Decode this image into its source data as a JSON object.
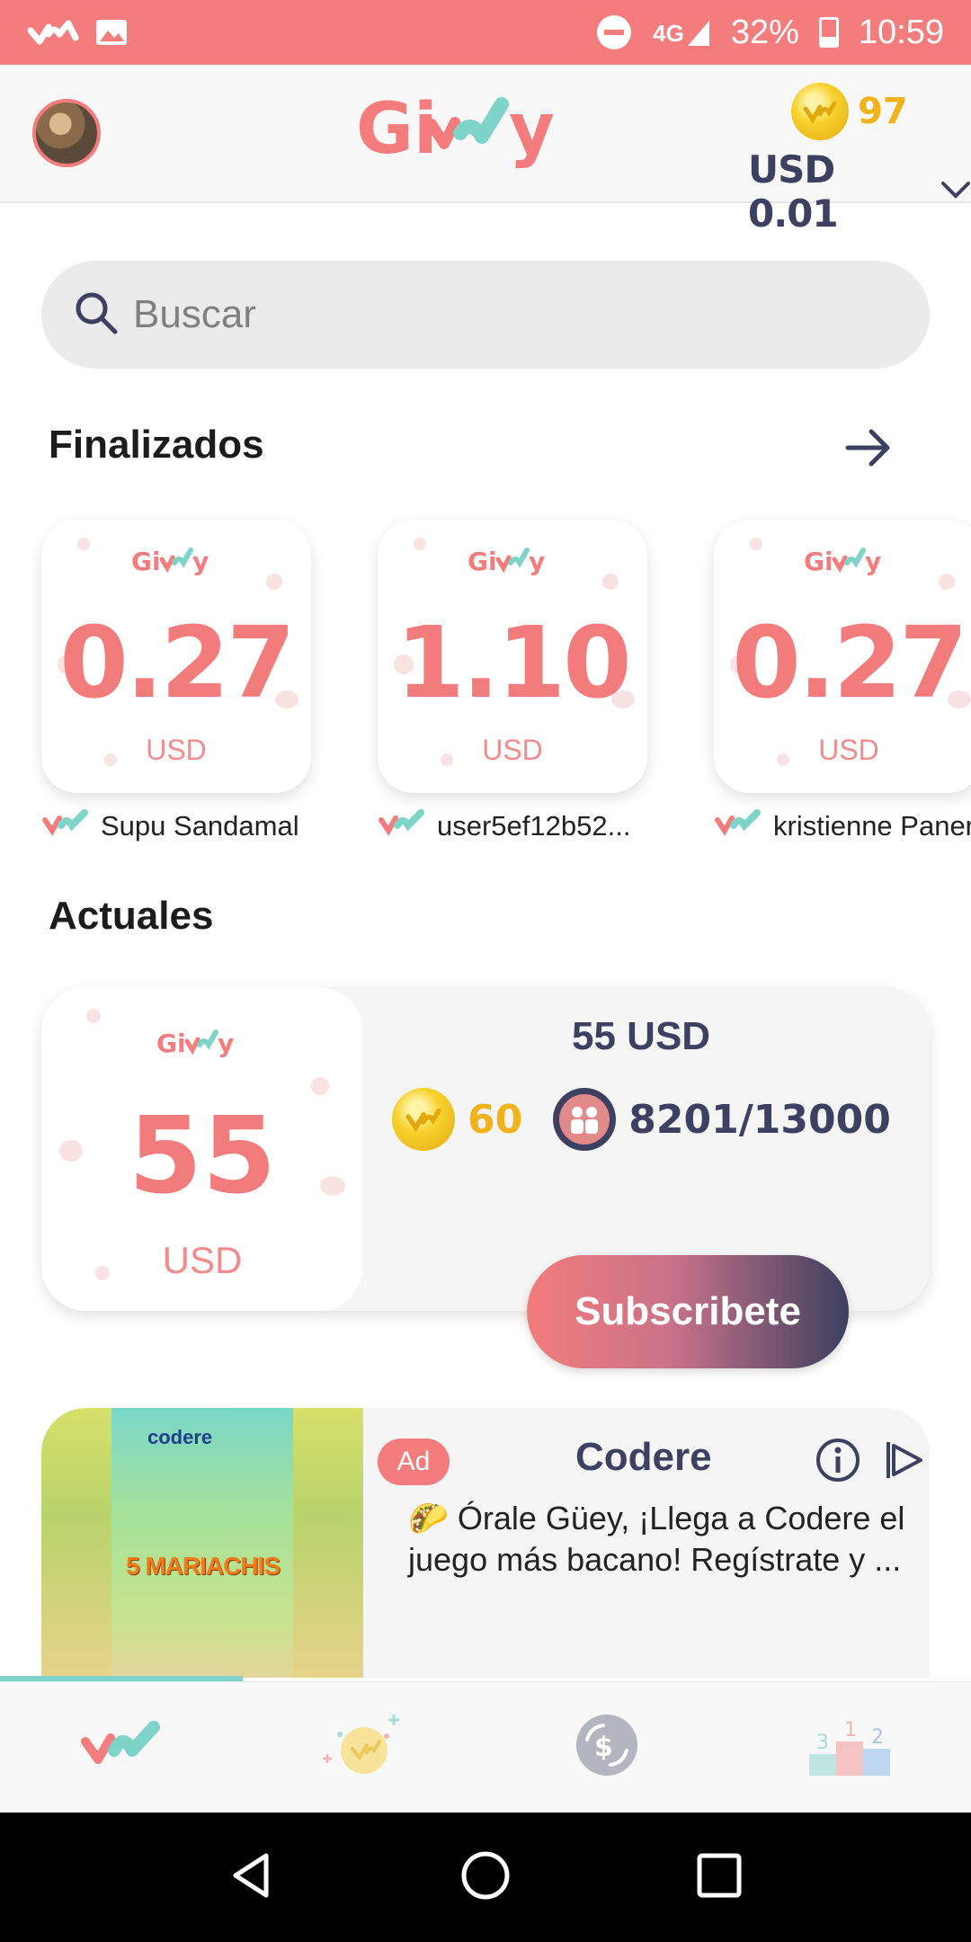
{
  "status_bar": {
    "network": "4G",
    "battery": "32%",
    "battery_level": 0.32,
    "time": "10:59"
  },
  "header": {
    "app_name": "Givvy",
    "coin_count": "97",
    "balance": "USD 0.01"
  },
  "search": {
    "placeholder": "Buscar"
  },
  "finished": {
    "title": "Finalizados",
    "cards": [
      {
        "amount": "0.27",
        "currency": "USD",
        "user": "Supu Sandamal"
      },
      {
        "amount": "1.10",
        "currency": "USD",
        "user": "user5ef12b52..."
      },
      {
        "amount": "0.27",
        "currency": "USD",
        "user": "kristienne Paner"
      }
    ]
  },
  "current": {
    "title": "Actuales",
    "card": {
      "amount": "55",
      "currency": "USD",
      "prize_title": "55 USD",
      "coins_cost": "60",
      "participants": "8201/13000",
      "subscribe_label": "Subscribete"
    }
  },
  "ad": {
    "badge": "Ad",
    "advertiser": "Codere",
    "body": "🌮 Órale Güey, ¡Llega a Codere el juego más bacano! Regístrate y ...",
    "image_brand": "codere",
    "image_title": "5 MARIACHIS"
  },
  "colors": {
    "accent": "#f47c7c",
    "navy": "#3d4060",
    "teal": "#7fd4c9",
    "gold": "#f2b21a"
  },
  "bottom_nav": [
    "home-icon",
    "coins-bonus-icon",
    "cash-exchange-icon",
    "leaderboard-podium-icon"
  ]
}
